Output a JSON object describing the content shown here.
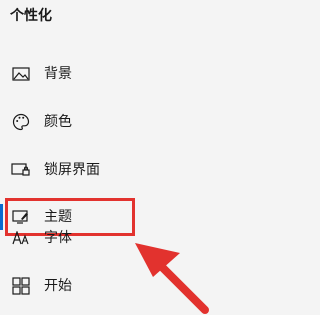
{
  "page": {
    "title": "个性化"
  },
  "nav": {
    "items": [
      {
        "label": "背景",
        "icon": "image-icon"
      },
      {
        "label": "颜色",
        "icon": "palette-icon"
      },
      {
        "label": "锁屏界面",
        "icon": "lock-screen-icon"
      },
      {
        "label": "主题",
        "icon": "theme-icon",
        "selected": true
      },
      {
        "label": "字体",
        "icon": "font-icon"
      },
      {
        "label": "开始",
        "icon": "start-icon"
      }
    ]
  },
  "annotation": {
    "highlight_color": "#e2322e",
    "accent_color": "#0a6acf"
  }
}
